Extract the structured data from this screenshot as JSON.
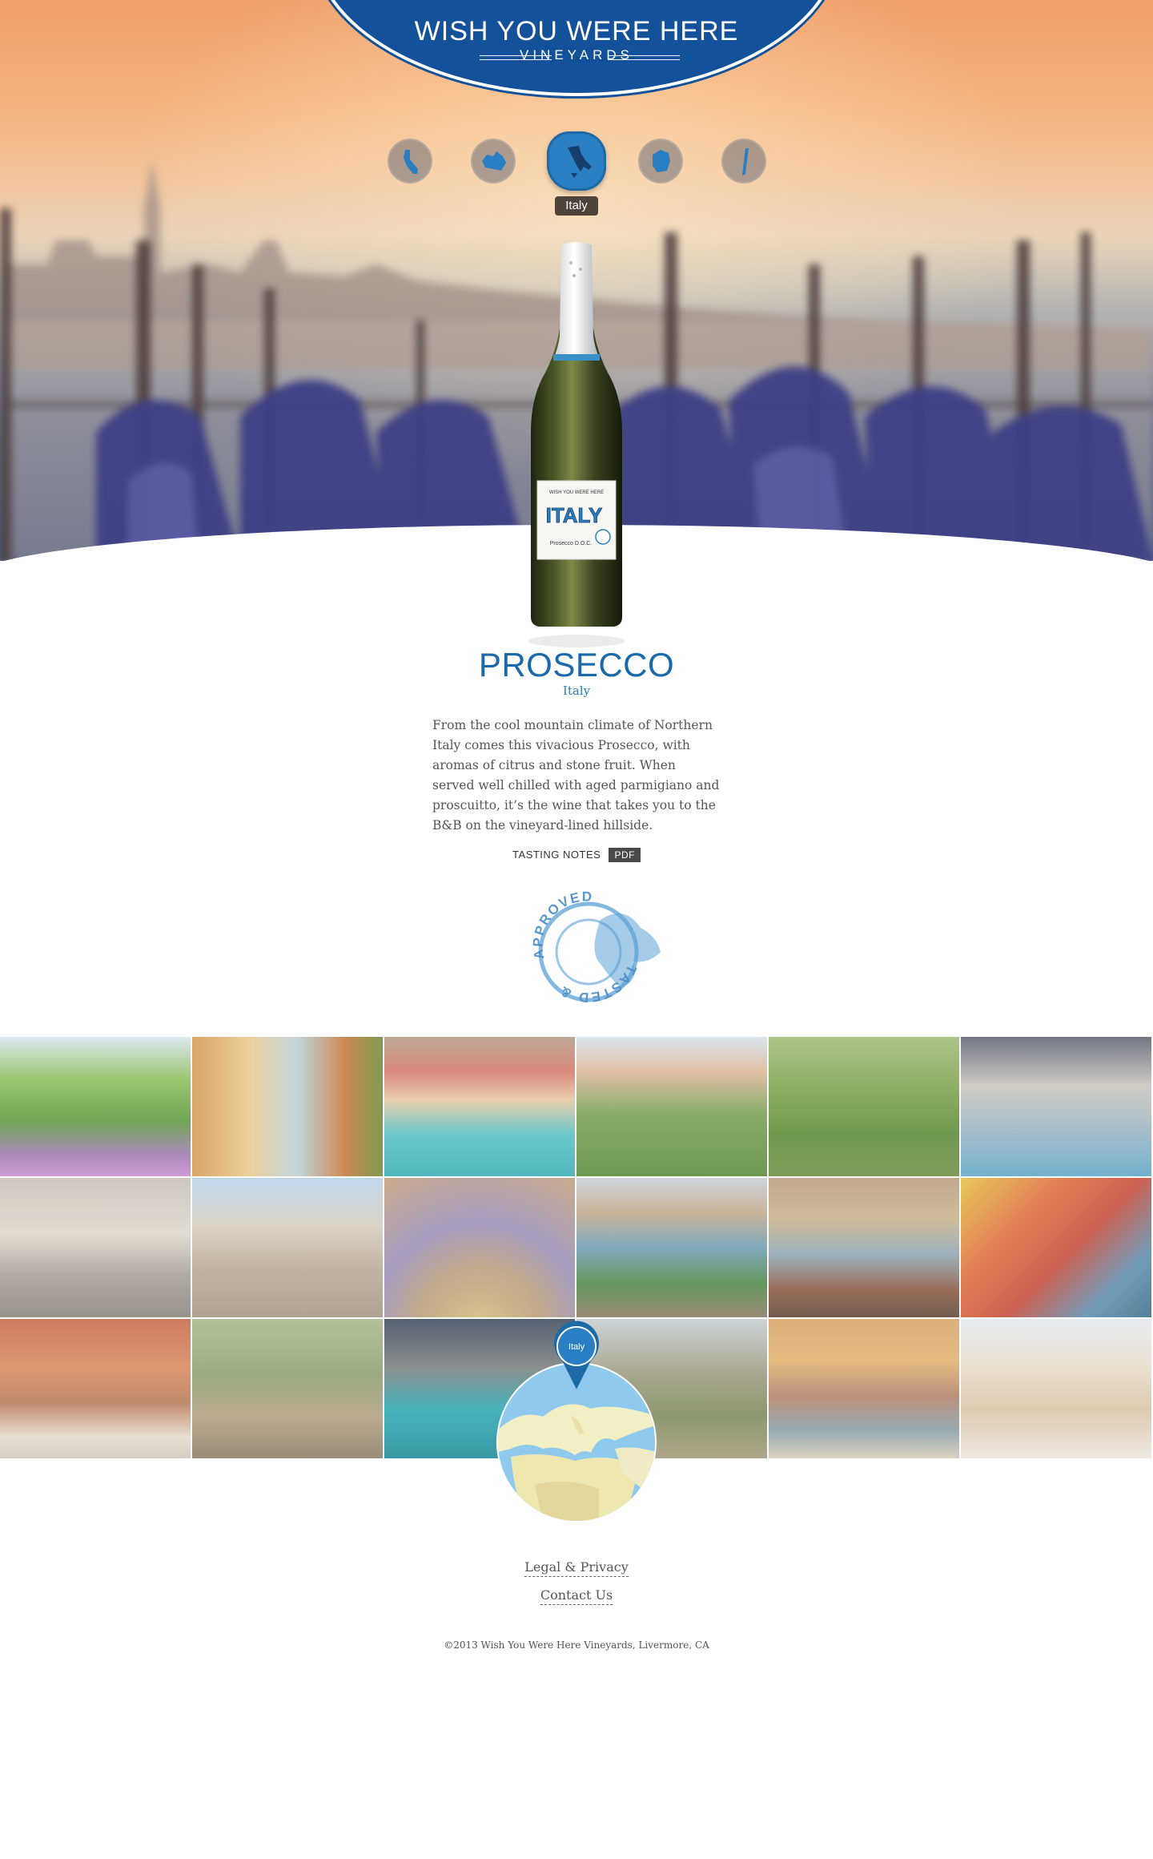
{
  "brand": {
    "title": "WISH YOU WERE HERE",
    "subtitle": "VINEYARDS",
    "color_primary": "#14519b"
  },
  "region_nav": {
    "regions": [
      {
        "icon": "california-map-icon",
        "label": ""
      },
      {
        "icon": "australia-map-icon",
        "label": ""
      },
      {
        "icon": "italy-map-icon",
        "label": "Italy",
        "active": true
      },
      {
        "icon": "france-map-icon",
        "label": ""
      },
      {
        "icon": "chile-map-icon",
        "label": ""
      }
    ],
    "tooltip": "Italy"
  },
  "bottle": {
    "label_brand": "WISH YOU WERE HERE",
    "label_country": "ITALY",
    "label_type": "Prosecco D.O.C."
  },
  "product": {
    "name": "PROSECCO",
    "region": "Italy",
    "description": "From the cool mountain climate of Northern Italy comes this vivacious Prosecco, with aromas of citrus and stone fruit. When served well chilled with aged parmigiano and proscuitto, it’s the wine that takes you to the B&B on the vineyard-lined hillside.",
    "tasting_notes_label": "TASTING NOTES",
    "pdf_label": "PDF",
    "accent": "#1a6aab"
  },
  "stamp": {
    "top_text": "APPROVED",
    "bottom_text": "TASTED &"
  },
  "gallery": {
    "rows": 3,
    "cols": 6,
    "tiles": [
      "alpine-meadow",
      "lake-como-street",
      "cinque-terre-harbor",
      "tuscan-hill-town",
      "vineyard-rows",
      "trevi-fountain",
      "navona-fountain",
      "colosseum",
      "painted-dome",
      "verona-river",
      "sistine-chapel",
      "manarola-cliffs",
      "piazza-cafe",
      "sorrento-cliffs",
      "venice-canal-night",
      "hill-village",
      "riomaggiore-houses",
      "positano-terrace"
    ]
  },
  "map_pin": {
    "label": "Italy"
  },
  "footer": {
    "legal": "Legal & Privacy",
    "contact": "Contact Us",
    "copyright": "©2013 Wish You Were Here Vineyards, Livermore, CA"
  }
}
